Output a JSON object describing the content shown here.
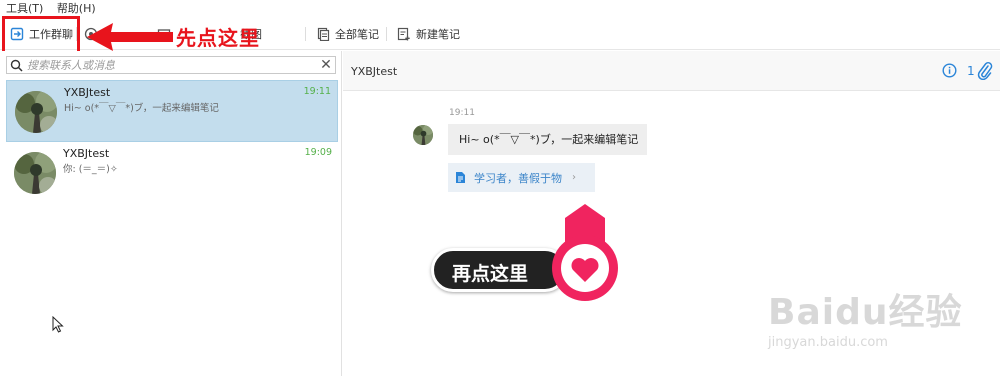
{
  "menu": {
    "items": [
      "工具(T)",
      "帮助(H)"
    ]
  },
  "toolbar": {
    "work_group": "工作群聊",
    "screenshot": "截图",
    "all_notes": "全部笔记",
    "new_note": "新建笔记"
  },
  "annotation": {
    "first": "先点这里",
    "second": "再点这里"
  },
  "search": {
    "placeholder": "搜索联系人或消息"
  },
  "conversations": [
    {
      "name": "YXBJtest",
      "preview": "Hi~ o(*￣▽￣*)ブ，一起来编辑笔记",
      "time": "19:11"
    },
    {
      "name": "YXBJtest",
      "preview": "你: (＝_＝)✧",
      "time": "19:09"
    }
  ],
  "chat": {
    "title": "YXBJtest",
    "count": "1",
    "message_time": "19:11",
    "message_text": "Hi~ o(*￣▽￣*)ブ，一起来编辑笔记",
    "note_card_title": "学习者，善假于物"
  },
  "watermark": {
    "brand": "Baidu经验",
    "url": "jingyan.baidu.com"
  },
  "colors": {
    "accent": "#2b85d8",
    "annotation_red": "#e8141c",
    "selected_bg": "#c3dded",
    "time_green": "#55b04a",
    "pin_pink": "#f0245f"
  }
}
